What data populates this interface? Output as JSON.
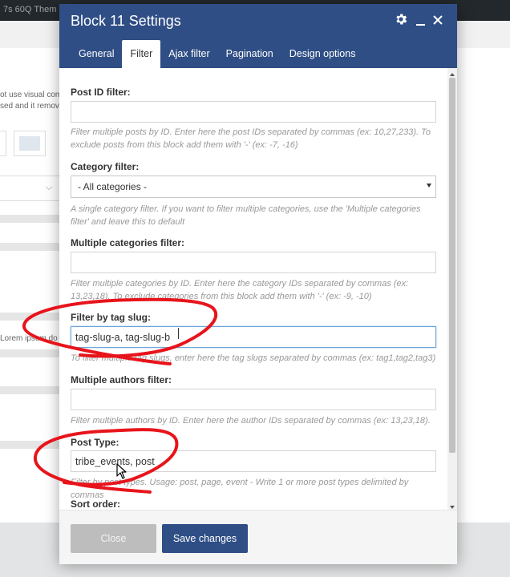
{
  "background": {
    "admin_bar_text": "7s  60Q  Them",
    "partial_text_1": "ot use visual com",
    "partial_text_2": "sed and it remov",
    "partial_text_3": "Lorem ipsum do"
  },
  "modal": {
    "title": "Block 11 Settings",
    "header_icons": [
      "gear-icon",
      "minimize-icon",
      "close-icon"
    ],
    "tabs": [
      {
        "label": "General",
        "active": false
      },
      {
        "label": "Filter",
        "active": true
      },
      {
        "label": "Ajax filter",
        "active": false
      },
      {
        "label": "Pagination",
        "active": false
      },
      {
        "label": "Design options",
        "active": false
      }
    ],
    "fields": {
      "post_id": {
        "label": "Post ID filter:",
        "value": "",
        "help": "Filter multiple posts by ID. Enter here the post IDs separated by commas (ex: 10,27,233). To exclude posts from this block add them with '-' (ex: -7, -16)"
      },
      "category": {
        "label": "Category filter:",
        "value": "- All categories -",
        "help": "A single category filter. If you want to filter multiple categories, use the 'Multiple categories filter' and leave this to default"
      },
      "multiple_categories": {
        "label": "Multiple categories filter:",
        "value": "",
        "help": "Filter multiple categories by ID. Enter here the category IDs separated by commas (ex: 13,23,18). To exclude categories from this block add them with '-' (ex: -9, -10)"
      },
      "tag_slug": {
        "label": "Filter by tag slug:",
        "value": "tag-slug-a, tag-slug-b",
        "help": "To filter multiple tag slugs, enter here the tag slugs separated by commas (ex: tag1,tag2,tag3)"
      },
      "multiple_authors": {
        "label": "Multiple authors filter:",
        "value": "",
        "help": "Filter multiple authors by ID. Enter here the author IDs separated by commas (ex: 13,23,18)."
      },
      "post_type": {
        "label": "Post Type:",
        "value": "tribe_events, post",
        "help": "Filter by post types. Usage: post, page, event - Write 1 or more post types delimited by commas"
      },
      "sort_order": {
        "label": "Sort order:"
      }
    },
    "footer": {
      "close_label": "Close",
      "save_label": "Save changes"
    }
  },
  "colors": {
    "header": "#2f4e85",
    "save_button": "#2f4e85",
    "close_button": "#bdbdbd",
    "annotation": "#e8141b"
  }
}
